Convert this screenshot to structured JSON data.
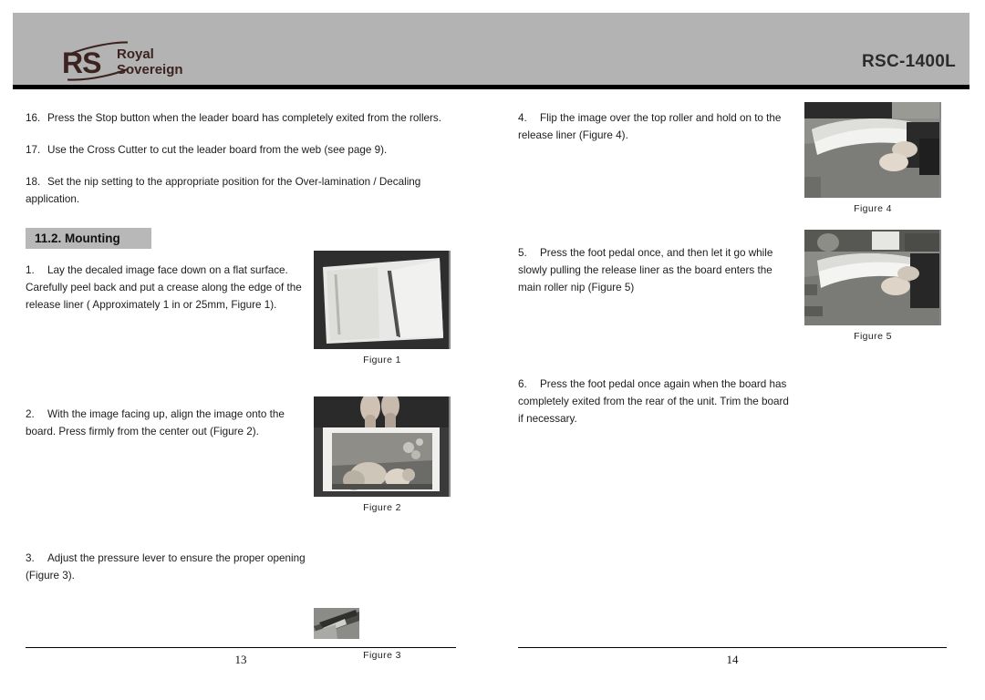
{
  "header": {
    "logo_mark": "RS",
    "logo_line1": "Royal",
    "logo_line2": "Sovereign",
    "model": "RSC-1400L",
    "band_color": "#b3b3b3",
    "rule_color": "#000000"
  },
  "left_page": {
    "items": [
      {
        "num": "16.",
        "text": "Press the Stop button when the leader board has completely exited from the rollers."
      },
      {
        "num": "17.",
        "text": "Use the Cross Cutter to cut the leader board from the web (see page 9)."
      },
      {
        "num": "18.",
        "text": "Set the nip setting to the appropriate position for the Over-lamination / Decaling application."
      }
    ],
    "section_heading": "11.2. Mounting",
    "mounting_items": [
      {
        "num": "1.",
        "text": "Lay the decaled image face down on a flat surface. Carefully peel back and put a crease along the edge of the release liner ( Approximately 1 in or 25mm, Figure 1)."
      },
      {
        "num": "2.",
        "text": "With the image facing up, align the image onto the board. Press firmly from the center out (Figure 2)."
      },
      {
        "num": "3.",
        "text": "Adjust the pressure lever to ensure the proper opening (Figure 3)."
      }
    ],
    "figures": [
      {
        "caption": "Figure  1",
        "alt": "white-board-with-crease-photo"
      },
      {
        "caption": "Figure  2",
        "alt": "hands-aligning-image-on-board-photo"
      },
      {
        "caption": "Figure  3",
        "alt": "pressure-lever-closeup-photo"
      }
    ],
    "page_number": "13"
  },
  "right_page": {
    "items": [
      {
        "num": "4.",
        "text": "Flip the image over the top roller and hold on to the release liner (Figure 4)."
      },
      {
        "num": "5.",
        "text": "Press the foot pedal once, and then let it go while slowly pulling the release liner as the board enters the main roller nip (Figure 5)"
      },
      {
        "num": "6.",
        "text": "Press the foot pedal once again when the board has completely exited from the rear of the unit.  Trim the board if necessary."
      }
    ],
    "figures": [
      {
        "caption": "Figure  4",
        "alt": "flipping-sheet-over-roller-photo"
      },
      {
        "caption": "Figure  5",
        "alt": "board-entering-roller-nip-photo"
      }
    ],
    "page_number": "14"
  }
}
